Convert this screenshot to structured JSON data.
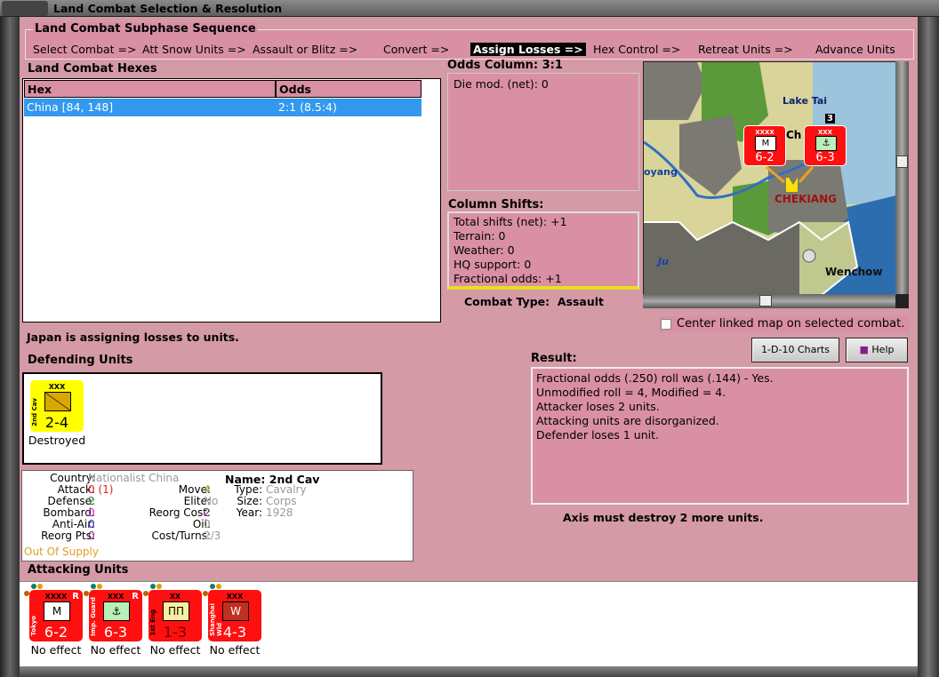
{
  "window": {
    "title": "Land Combat Selection & Resolution"
  },
  "sequence": {
    "title": "Land Combat Subphase Sequence",
    "steps": [
      "Select Combat =>",
      "Att Snow Units =>",
      "Assault or Blitz =>",
      "Convert =>",
      "Assign Losses =>",
      "Hex Control =>",
      "Retreat Units =>",
      "Advance Units"
    ],
    "active_index": 4
  },
  "hexes": {
    "title": "Land Combat Hexes",
    "columns": [
      "Hex",
      "Odds"
    ],
    "rows": [
      {
        "hex": "China [84, 148]",
        "odds": "2:1 (8.5:4)",
        "selected": true
      }
    ]
  },
  "odds": {
    "title": "Odds Column: 3:1",
    "die_mod": "Die mod. (net): 0"
  },
  "shifts": {
    "title": "Column Shifts:",
    "lines": [
      "Total shifts (net): +1",
      "Terrain: 0",
      "Weather: 0",
      "HQ support: 0",
      "Fractional odds: +1"
    ]
  },
  "combat_type": {
    "label": "Combat Type:",
    "value": "Assault"
  },
  "map": {
    "labels": {
      "lake": "Lake Tai",
      "city1": "oyang",
      "region": "CHEKIANG",
      "city2": "Wenchow",
      "river": "Ju",
      "partial": "Ch",
      "stack_count": "3"
    },
    "units": [
      {
        "size": "XXXX",
        "sym": "M",
        "str": "6-2",
        "name": "Tokyo"
      },
      {
        "size": "XXX",
        "sym": "⚓",
        "str": "6-3",
        "name": "Imp. Guard"
      }
    ]
  },
  "center_map": {
    "label": "Center linked map on selected combat.",
    "checked": false
  },
  "buttons": {
    "charts": "1-D-10 Charts",
    "help": "Help"
  },
  "status_msg": "Japan is assigning losses to units.",
  "defending": {
    "title": "Defending Units",
    "units": [
      {
        "name": "2nd Cav",
        "size": "XXX",
        "str": "2-4",
        "status": "Destroyed",
        "color": "#ffff00"
      }
    ]
  },
  "details": {
    "country_l": "Country:",
    "country": "Nationalist China",
    "attack_l": "Attack:",
    "attack": "0 (1)",
    "defense_l": "Defense:",
    "defense": "2",
    "bombard_l": "Bombard:",
    "bombard": "0",
    "aa_l": "Anti-Air:",
    "aa": "0",
    "reorg_l": "Reorg Pts:",
    "reorg": "0",
    "supply": "Out Of Supply",
    "move_l": "Move:",
    "move": "4",
    "elite_l": "Elite:",
    "elite": "No",
    "rcost_l": "Reorg Cost:",
    "rcost": "2",
    "oil_l": "Oil:",
    "oil": "0",
    "ct_l": "Cost/Turns:",
    "ct": "2/3",
    "name": "Name: 2nd Cav",
    "type_l": "Type:",
    "type": "Cavalry",
    "size_l": "Size:",
    "size": "Corps",
    "year_l": "Year:",
    "year": "1928"
  },
  "result": {
    "title": "Result:",
    "lines": [
      "Fractional odds (.250) roll was (.144)  - Yes.",
      "Unmodified roll = 4, Modified = 4.",
      "Attacker loses 2 units.",
      "Attacking units are disorganized.",
      "Defender loses 1 unit."
    ]
  },
  "axis_msg": "Axis must destroy 2 more units.",
  "attacking": {
    "title": "Attacking Units",
    "units": [
      {
        "name": "Tokyo",
        "size": "XXXX",
        "sym": "M",
        "str": "6-2",
        "status": "No effect",
        "r": "R",
        "symbg": "#ffffff"
      },
      {
        "name": "Imp. Guard",
        "size": "XXX",
        "sym": "⚓",
        "str": "6-3",
        "status": "No effect",
        "r": "R",
        "symbg": "#b8f0b8"
      },
      {
        "name": "1st Eng",
        "size": "XX",
        "sym": "ПП",
        "str": "1-3",
        "status": "No effect",
        "r": "",
        "symbg": "#f8f0a0"
      },
      {
        "name": "Shanghai Wld",
        "size": "XXX",
        "sym": "W",
        "str": "4-3",
        "status": "No effect",
        "r": "",
        "symbg": "#c03020"
      }
    ]
  }
}
